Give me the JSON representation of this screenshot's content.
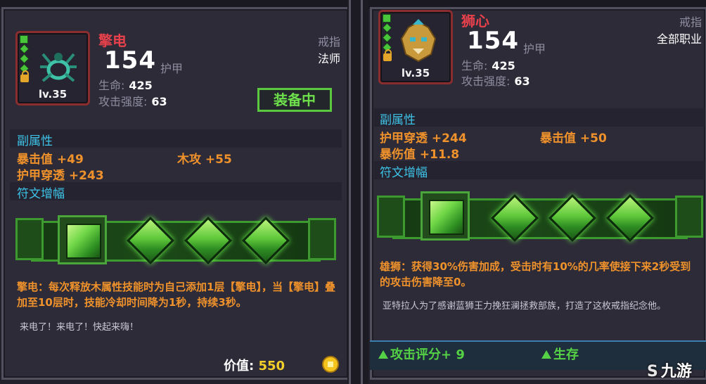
{
  "left": {
    "name": "擎电",
    "level": "lv.35",
    "armor_value": "154",
    "armor_unit": "护甲",
    "hp_label": "生命:",
    "hp_value": "425",
    "atk_label": "攻击强度:",
    "atk_value": "63",
    "slot": "戒指",
    "class": "法师",
    "equipped": "装备中",
    "sub_title": "副属性",
    "sub_stats": [
      "暴击值 +49",
      "木攻 +55",
      "护甲穿透 +243"
    ],
    "rune_title": "符文增幅",
    "effect": "擎电：每次释放木属性技能时为自己添加1层【擎电】，当【擎电】叠加至10层时，技能冷却时间降为1秒，持续3秒。",
    "flavor": "来电了！来电了！快起来嗨！",
    "price_label": "价值:",
    "price_value": "550"
  },
  "right": {
    "name": "狮心",
    "level": "lv.35",
    "armor_value": "154",
    "armor_unit": "护甲",
    "hp_label": "生命:",
    "hp_value": "425",
    "atk_label": "攻击强度:",
    "atk_value": "63",
    "slot": "戒指",
    "class": "全部职业",
    "sub_title": "副属性",
    "sub_stats": [
      "护甲穿透 +244",
      "暴击值 +50",
      "暴伤值 +11.8"
    ],
    "rune_title": "符文增幅",
    "effect": "雄狮：获得30%伤害加成，受击时有10%的几率使接下来2秒受到的攻击伤害降至0。",
    "flavor": "亚特拉人为了感谢蓝狮王力挽狂澜拯救部族，打造了这枚戒指纪念他。",
    "score_attack": "攻击评分+ 9",
    "score_survive": "生存"
  },
  "watermark": "九游",
  "colors": {
    "name_red": "#e8414b",
    "section_blue": "#3ec3e8",
    "stat_orange": "#f0922b",
    "equip_green": "#5ac93e"
  }
}
